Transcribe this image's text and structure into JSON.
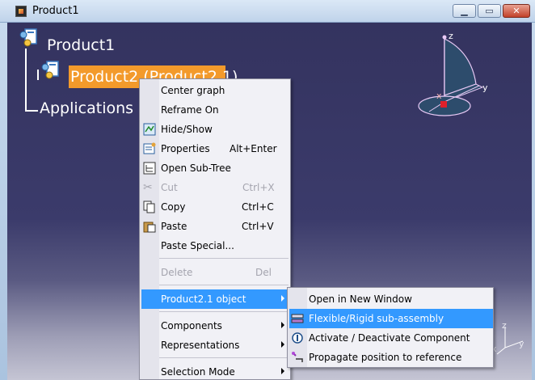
{
  "window": {
    "title": "Product1"
  },
  "tree": {
    "root": "Product1",
    "child": "Product2 (Product2.1)",
    "apps": "Applications"
  },
  "compass": {
    "z": "z",
    "y": "y",
    "x": "x"
  },
  "axes": {
    "z": "z",
    "y": "y",
    "x": "x"
  },
  "menu": {
    "items": [
      {
        "label": "Center graph",
        "shortcut": ""
      },
      {
        "label": "Reframe On",
        "shortcut": ""
      },
      {
        "label": "Hide/Show",
        "shortcut": ""
      },
      {
        "label": "Properties",
        "shortcut": "Alt+Enter"
      },
      {
        "label": "Open Sub-Tree",
        "shortcut": ""
      },
      {
        "label": "Cut",
        "shortcut": "Ctrl+X"
      },
      {
        "label": "Copy",
        "shortcut": "Ctrl+C"
      },
      {
        "label": "Paste",
        "shortcut": "Ctrl+V"
      },
      {
        "label": "Paste Special...",
        "shortcut": ""
      },
      {
        "label": "Delete",
        "shortcut": "Del"
      },
      {
        "label": "Product2.1 object",
        "shortcut": ""
      },
      {
        "label": "Components",
        "shortcut": ""
      },
      {
        "label": "Representations",
        "shortcut": ""
      },
      {
        "label": "Selection Mode",
        "shortcut": ""
      }
    ]
  },
  "submenu": {
    "items": [
      {
        "label": "Open in New Window"
      },
      {
        "label": "Flexible/Rigid sub-assembly"
      },
      {
        "label": "Activate / Deactivate Component"
      },
      {
        "label": "Propagate position to reference"
      }
    ]
  },
  "colors": {
    "highlight": "#f39a2b",
    "menu_selected": "#3399ff",
    "background_top": "#34335f"
  }
}
